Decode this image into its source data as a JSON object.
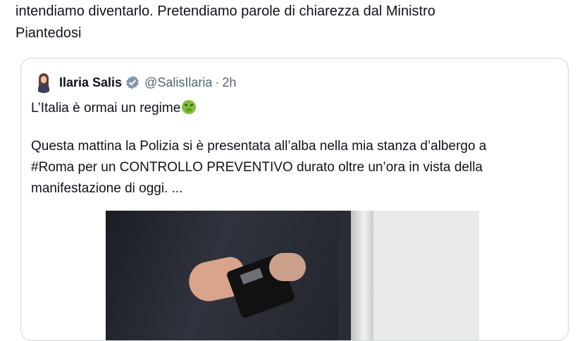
{
  "outer_tweet": {
    "text_lines": [
      "intendiamo diventarlo. Pretendiamo parole di chiarezza dal Ministro",
      "Piantedosi"
    ]
  },
  "quoted_tweet": {
    "display_name": "Ilaria Salis",
    "handle": "@SalisIlaria",
    "separator": "·",
    "time": "2h",
    "verified": true,
    "first_line": "L’Italia è ormai un regime",
    "emoji": "nauseated-face",
    "paragraph_lines": [
      "Questa mattina la Polizia si è presentata all’alba nella mia stanza d’albergo a",
      "#Roma per un CONTROLLO PREVENTIVO durato oltre un’ora in vista della",
      "manifestazione di oggi. ..."
    ],
    "media": {
      "description_icon": "photo"
    }
  },
  "colors": {
    "text": "#0f1419",
    "secondary": "#536471",
    "border": "#cfd9de",
    "verified": "#829aab"
  }
}
